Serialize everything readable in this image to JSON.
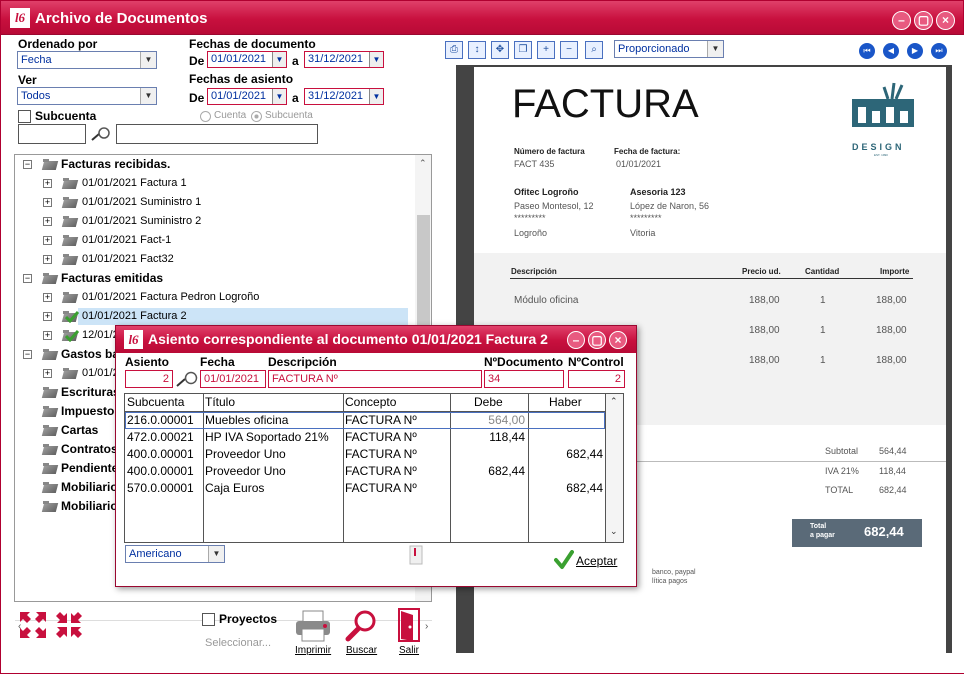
{
  "window": {
    "title": "Archivo de Documentos",
    "logo": "l6"
  },
  "filters": {
    "ordered_label": "Ordenado por",
    "ordered_value": "Fecha",
    "ver_label": "Ver",
    "ver_value": "Todos",
    "subcuenta_label": "Subcuenta",
    "fechas_doc_label": "Fechas de documento",
    "de": "De",
    "a": "a",
    "doc_from": "01/01/2021",
    "doc_to": "31/12/2021",
    "fechas_asiento_label": "Fechas de asiento",
    "asi_from": "01/01/2021",
    "asi_to": "31/12/2021",
    "radio_cuenta": "Cuenta",
    "radio_subcuenta": "Subcuenta"
  },
  "tree": [
    {
      "label": "Facturas recibidas.",
      "bold": true,
      "level": 0,
      "sign": "−"
    },
    {
      "label": "01/01/2021 Factura 1",
      "level": 1,
      "sign": "+"
    },
    {
      "label": "01/01/2021 Suministro 1",
      "level": 1,
      "sign": "+"
    },
    {
      "label": "01/01/2021 Suministro 2",
      "level": 1,
      "sign": "+"
    },
    {
      "label": "01/01/2021 Fact-1",
      "level": 1,
      "sign": "+"
    },
    {
      "label": "01/01/2021 Fact32",
      "level": 1,
      "sign": "+"
    },
    {
      "label": "Facturas emitidas",
      "bold": true,
      "level": 0,
      "sign": "−"
    },
    {
      "label": "01/01/2021 Factura Pedron Logroño",
      "level": 1,
      "sign": "+"
    },
    {
      "label": "01/01/2021 Factura 2",
      "level": 1,
      "sign": "+",
      "selected": true,
      "check": true
    },
    {
      "label": "12/01/2",
      "level": 1,
      "sign": "+",
      "check": true
    },
    {
      "label": "Gastos ba",
      "bold": true,
      "level": 0,
      "sign": "−"
    },
    {
      "label": "01/01/2",
      "level": 1,
      "sign": "+"
    },
    {
      "label": "Escrituras",
      "bold": true,
      "level": 0
    },
    {
      "label": "Impuesto",
      "bold": true,
      "level": 0
    },
    {
      "label": "Cartas",
      "bold": true,
      "level": 0
    },
    {
      "label": "Contratos",
      "bold": true,
      "level": 0
    },
    {
      "label": "Pendiente",
      "bold": true,
      "level": 0
    },
    {
      "label": "Mobiliario",
      "bold": true,
      "level": 0
    },
    {
      "label": "Mobiliario",
      "bold": true,
      "level": 0
    }
  ],
  "bottom": {
    "proyectos": "Proyectos",
    "seleccionar": "Seleccionar...",
    "imprimir": "Imprimir",
    "buscar": "Buscar",
    "salir": "Salir"
  },
  "viewer": {
    "zoom_mode": "Proporcionado"
  },
  "invoice": {
    "title": "FACTURA",
    "brand": "DESIGN",
    "brand_sub": "EST. 1990",
    "num_label": "Número de factura",
    "num_value": "FACT 435",
    "date_label": "Fecha de factura:",
    "date_value": "01/01/2021",
    "from_name": "Ofitec Logroño",
    "from_addr": "Paseo Montesol, 12",
    "from_stars": "*********",
    "from_city": "Logroño",
    "to_name": "Asesoria 123",
    "to_addr": "López de Naron, 56",
    "to_stars": "*********",
    "to_city": "Vitoria",
    "cols": [
      "Descripción",
      "Precio ud.",
      "Cantidad",
      "Importe"
    ],
    "rows": [
      {
        "desc": "Módulo oficina",
        "price": "188,00",
        "qty": "1",
        "amount": "188,00"
      },
      {
        "desc": "",
        "price": "188,00",
        "qty": "1",
        "amount": "188,00"
      },
      {
        "desc": "",
        "price": "188,00",
        "qty": "1",
        "amount": "188,00"
      }
    ],
    "subtotal_label": "Subtotal",
    "subtotal": "564,44",
    "iva_label": "IVA 21%",
    "iva": "118,44",
    "total_label": "TOTAL",
    "total": "682,44",
    "pay_label_1": "Total",
    "pay_label_2": "a pagar",
    "pay_value": "682,44",
    "note_1": "banco, paypal",
    "note_2": "lítica pagos"
  },
  "dialog": {
    "title": "Asiento correspondiente al documento 01/01/2021 Factura 2",
    "asiento_label": "Asiento",
    "asiento": "2",
    "fecha_label": "Fecha",
    "fecha": "01/01/2021",
    "desc_label": "Descripción",
    "desc": "FACTURA Nº",
    "ndoc_label": "NºDocumento",
    "ndoc": "34",
    "nctrl_label": "NºControl",
    "nctrl": "2",
    "cols": [
      "Subcuenta",
      "Título",
      "Concepto",
      "Debe",
      "Haber"
    ],
    "rows": [
      {
        "sub": "216.0.00001",
        "tit": "Muebles oficina",
        "con": "FACTURA Nº",
        "debe": "564,00",
        "haber": ""
      },
      {
        "sub": "472.0.00021",
        "tit": "HP IVA Soportado 21%",
        "con": "FACTURA Nº",
        "debe": "118,44",
        "haber": ""
      },
      {
        "sub": "400.0.00001",
        "tit": "Proveedor Uno",
        "con": "FACTURA Nº",
        "debe": "",
        "haber": "682,44"
      },
      {
        "sub": "400.0.00001",
        "tit": "Proveedor Uno",
        "con": "FACTURA Nº",
        "debe": "682,44",
        "haber": ""
      },
      {
        "sub": "570.0.00001",
        "tit": "Caja Euros",
        "con": "FACTURA Nº",
        "debe": "",
        "haber": "682,44"
      }
    ],
    "format": "Americano",
    "aceptar": "Aceptar"
  }
}
